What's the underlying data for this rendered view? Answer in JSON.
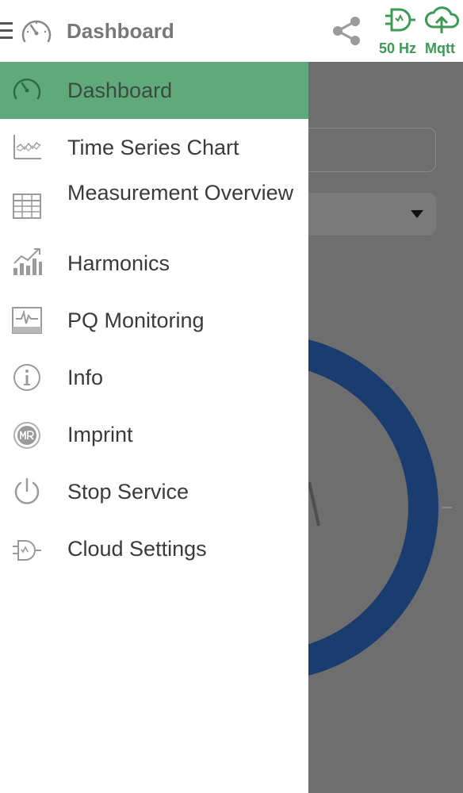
{
  "appbar": {
    "title": "Dashboard",
    "status_frequency": "50 Hz",
    "status_connection": "Mqtt",
    "icons": [
      "menu-icon",
      "gauge-icon",
      "share-icon",
      "plug-icon",
      "cloud-upload-icon"
    ]
  },
  "drawer": {
    "items": [
      {
        "label": "Dashboard",
        "icon": "gauge-icon",
        "active": true
      },
      {
        "label": "Time Series Chart",
        "icon": "line-chart-icon",
        "active": false
      },
      {
        "label": "Measurement Overview",
        "icon": "table-icon",
        "active": false
      },
      {
        "label": "Harmonics",
        "icon": "bar-chart-icon",
        "active": false
      },
      {
        "label": "PQ Monitoring",
        "icon": "monitor-waveform-icon",
        "active": false
      },
      {
        "label": "Info",
        "icon": "info-icon",
        "active": false
      },
      {
        "label": "Imprint",
        "icon": "mr-logo-icon",
        "active": false
      },
      {
        "label": "Stop Service",
        "icon": "power-icon",
        "active": false
      },
      {
        "label": "Cloud Settings",
        "icon": "plug-icon",
        "active": false
      }
    ]
  },
  "colors": {
    "accent_green": "#5fa97a",
    "status_green": "#3c9a55",
    "ring_blue": "#1a3c6e",
    "scrim": "#6e6e6e"
  }
}
